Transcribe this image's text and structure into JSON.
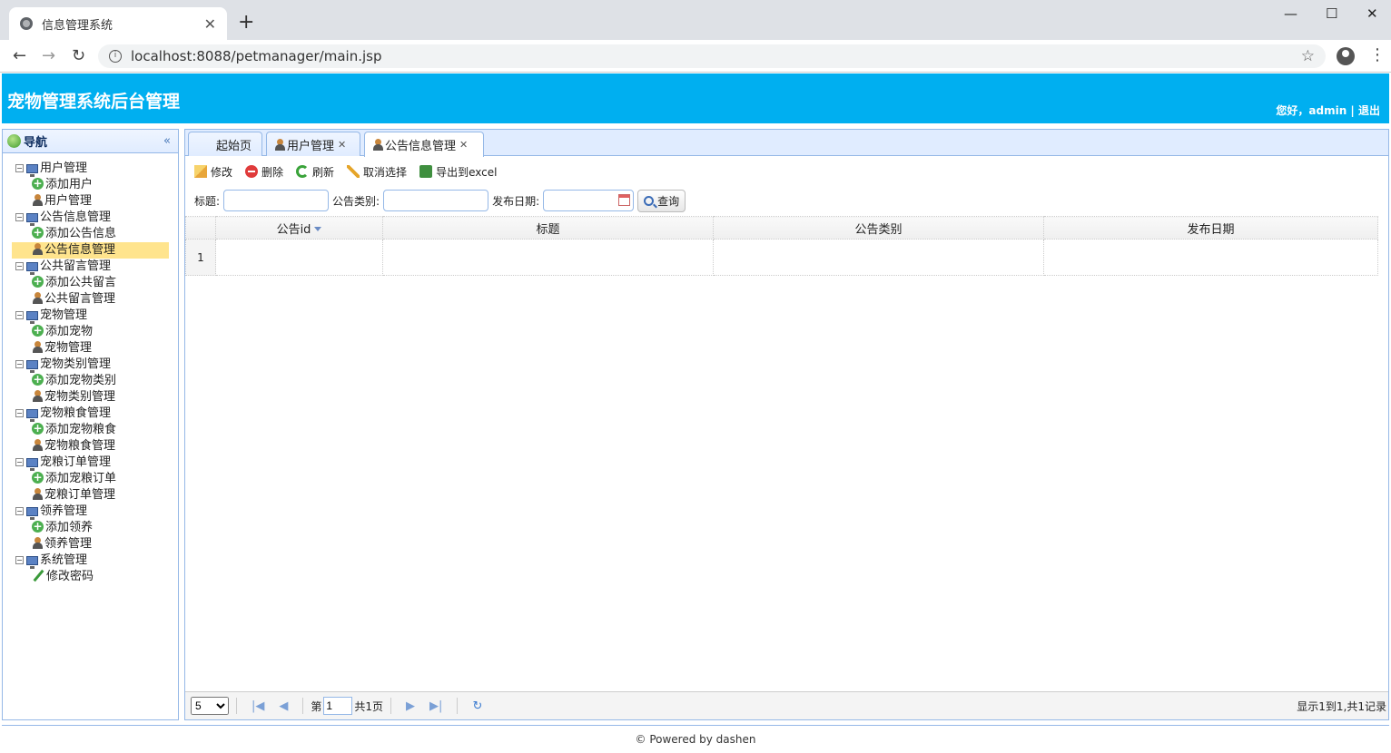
{
  "browser": {
    "tab_title": "信息管理系统",
    "url": "localhost:8088/petmanager/main.jsp"
  },
  "header": {
    "title": "宠物管理系统后台管理",
    "greeting": "您好，admin | 退出"
  },
  "nav": {
    "title": "导航",
    "groups": [
      {
        "label": "用户管理",
        "children": [
          {
            "label": "添加用户",
            "icon": "add-icon"
          },
          {
            "label": "用户管理",
            "icon": "user-icon"
          }
        ]
      },
      {
        "label": "公告信息管理",
        "children": [
          {
            "label": "添加公告信息",
            "icon": "add-icon"
          },
          {
            "label": "公告信息管理",
            "icon": "user-icon"
          }
        ]
      },
      {
        "label": "公共留言管理",
        "children": [
          {
            "label": "添加公共留言",
            "icon": "add-icon"
          },
          {
            "label": "公共留言管理",
            "icon": "user-icon"
          }
        ]
      },
      {
        "label": "宠物管理",
        "children": [
          {
            "label": "添加宠物",
            "icon": "add-icon"
          },
          {
            "label": "宠物管理",
            "icon": "user-icon"
          }
        ]
      },
      {
        "label": "宠物类别管理",
        "children": [
          {
            "label": "添加宠物类别",
            "icon": "add-icon"
          },
          {
            "label": "宠物类别管理",
            "icon": "user-icon"
          }
        ]
      },
      {
        "label": "宠物粮食管理",
        "children": [
          {
            "label": "添加宠物粮食",
            "icon": "add-icon"
          },
          {
            "label": "宠物粮食管理",
            "icon": "user-icon"
          }
        ]
      },
      {
        "label": "宠粮订单管理",
        "children": [
          {
            "label": "添加宠粮订单",
            "icon": "add-icon"
          },
          {
            "label": "宠粮订单管理",
            "icon": "user-icon"
          }
        ]
      },
      {
        "label": "领养管理",
        "children": [
          {
            "label": "添加领养",
            "icon": "add-icon"
          },
          {
            "label": "领养管理",
            "icon": "user-icon"
          }
        ]
      },
      {
        "label": "系统管理",
        "children": [
          {
            "label": "修改密码",
            "icon": "pencil-icon"
          }
        ]
      }
    ],
    "selected": "公告信息管理"
  },
  "tabs": [
    {
      "label": "起始页",
      "closable": false
    },
    {
      "label": "用户管理",
      "closable": true
    },
    {
      "label": "公告信息管理",
      "closable": true,
      "active": true
    }
  ],
  "toolbar": {
    "edit": "修改",
    "delete": "删除",
    "refresh": "刷新",
    "cancel_select": "取消选择",
    "export": "导出到excel"
  },
  "search": {
    "title_label": "标题:",
    "type_label": "公告类别:",
    "date_label": "发布日期:",
    "query_label": "查询"
  },
  "grid": {
    "columns": [
      "公告id",
      "标题",
      "公告类别",
      "发布日期"
    ],
    "rows": [
      {
        "num": "1",
        "cells": [
          "",
          "",
          "",
          ""
        ]
      }
    ]
  },
  "pager": {
    "page_size": "5",
    "page_prefix": "第",
    "page_value": "1",
    "page_suffix": "共1页",
    "info": "显示1到1,共1记录"
  },
  "footer": {
    "text": "© Powered by dashen"
  },
  "colors": {
    "header_bg": "#00aff0",
    "selected_bg": "#ffe48d",
    "border": "#95b8e7"
  }
}
